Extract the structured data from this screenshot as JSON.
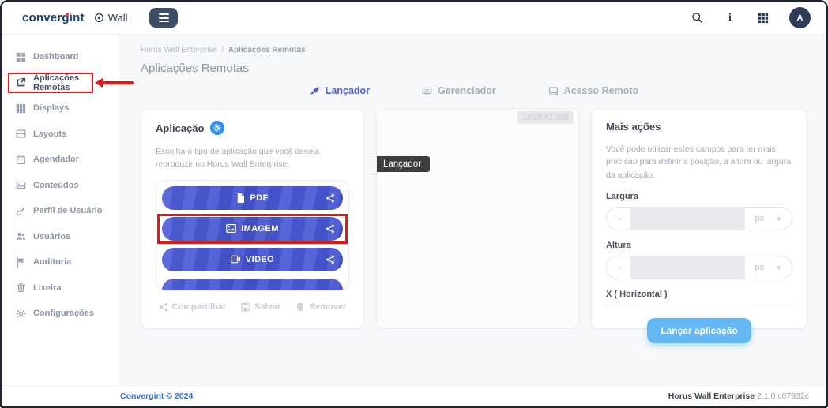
{
  "topbar": {
    "logo_text": "convergint",
    "product_label": "Wall",
    "avatar_initial": "A"
  },
  "sidebar": {
    "items": [
      {
        "label": "Dashboard",
        "icon": "dashboard-icon",
        "active": false
      },
      {
        "label": "Aplicações Remotas",
        "icon": "remote-apps-icon",
        "active": true
      },
      {
        "label": "Displays",
        "icon": "displays-icon",
        "active": false
      },
      {
        "label": "Layouts",
        "icon": "layouts-icon",
        "active": false
      },
      {
        "label": "Agendador",
        "icon": "calendar-icon",
        "active": false
      },
      {
        "label": "Conteúdos",
        "icon": "media-icon",
        "active": false
      },
      {
        "label": "Perfil de Usuário",
        "icon": "key-icon",
        "active": false
      },
      {
        "label": "Usuários",
        "icon": "users-icon",
        "active": false
      },
      {
        "label": "Auditoria",
        "icon": "flag-icon",
        "active": false
      },
      {
        "label": "Lixeira",
        "icon": "trash-icon",
        "active": false
      },
      {
        "label": "Configurações",
        "icon": "gear-icon",
        "active": false
      }
    ]
  },
  "breadcrumb": {
    "root": "Horus Wall Enterprise",
    "separator": "/",
    "current": "Aplicações Remotas"
  },
  "page": {
    "title": "Aplicações Remotas"
  },
  "tabs": [
    {
      "label": "Lançador",
      "icon": "rocket-icon",
      "active": true
    },
    {
      "label": "Gerenciador",
      "icon": "manager-icon",
      "active": false
    },
    {
      "label": "Acesso Remoto",
      "icon": "remote-access-icon",
      "active": false
    }
  ],
  "application_card": {
    "title": "Aplicação",
    "description": "Escolha o tipo de aplicação que você deseja reproduzir no Horus Wall Enterprise.",
    "type_buttons": [
      {
        "label": "PDF",
        "highlighted": false
      },
      {
        "label": "IMAGEM",
        "highlighted": true
      },
      {
        "label": "VIDEO",
        "highlighted": false
      }
    ],
    "footer_actions": [
      {
        "label": "Compartilhar"
      },
      {
        "label": "Salvar"
      },
      {
        "label": "Remover"
      }
    ]
  },
  "preview": {
    "resolution_badge": "1920X1080",
    "tag": "Lançador"
  },
  "more_actions_card": {
    "title": "Mais ações",
    "description": "Você pode utilizar estes campos para ter mais precisão para definir a posição, a altura ou largura da aplicação.",
    "fields": [
      {
        "label": "Largura",
        "minus": "−",
        "plus": "+",
        "unit": "px",
        "value": ""
      },
      {
        "label": "Altura",
        "minus": "−",
        "plus": "+",
        "unit": "px",
        "value": ""
      },
      {
        "label": "X ( Horizontal )"
      }
    ],
    "submit_label": "Lançar aplicação"
  },
  "footer": {
    "copyright": "Convergint © 2024",
    "brand": "Horus Wall Enterprise",
    "version": "2.1.0 c67932c"
  },
  "colors": {
    "primary_indigo": "#4a59d2",
    "active_tab_blue": "#4f5fd2",
    "launch_sky_blue": "#63b7f3",
    "annotation_red": "#e81515",
    "navy": "#2e3c59",
    "gear_badge_blue": "#2f8fef"
  }
}
